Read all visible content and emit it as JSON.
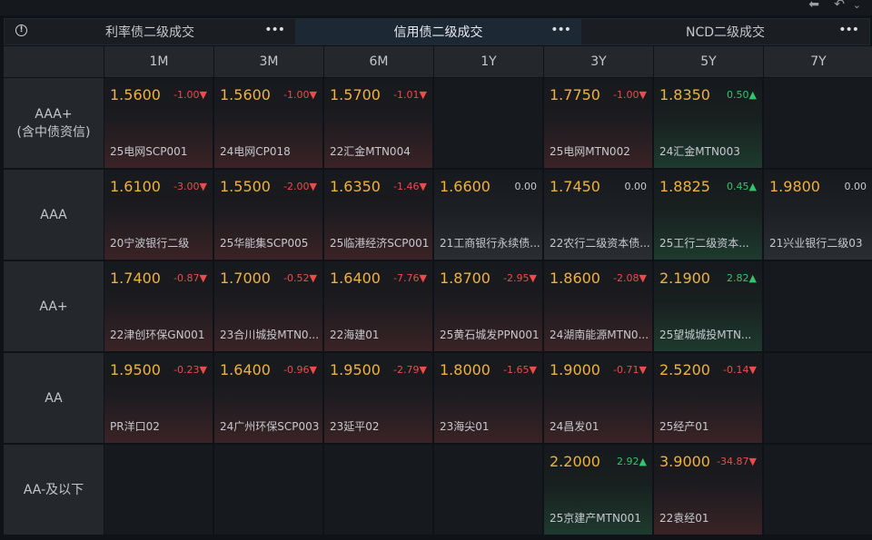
{
  "tabs": [
    {
      "label": "利率债二级成交",
      "more": "•••"
    },
    {
      "label": "信用债二级成交",
      "more": "•••"
    },
    {
      "label": "NCD二级成交",
      "more": "•••"
    }
  ],
  "columns": [
    "1M",
    "3M",
    "6M",
    "1Y",
    "3Y",
    "5Y",
    "7Y"
  ],
  "rows": [
    {
      "label": "AAA+",
      "sublabel": "(含中债资信)",
      "cells": [
        {
          "price": "1.5600",
          "change": "-1.00▼",
          "bond": "25电网SCP001",
          "trend": "down"
        },
        {
          "price": "1.5600",
          "change": "-1.00▼",
          "bond": "24电网CP018",
          "trend": "down"
        },
        {
          "price": "1.5700",
          "change": "-1.01▼",
          "bond": "22汇金MTN004",
          "trend": "down"
        },
        null,
        {
          "price": "1.7750",
          "change": "-1.00▼",
          "bond": "25电网MTN002",
          "trend": "down"
        },
        {
          "price": "1.8350",
          "change": "0.50▲",
          "bond": "24汇金MTN003",
          "trend": "up"
        },
        null
      ]
    },
    {
      "label": "AAA",
      "sublabel": "",
      "cells": [
        {
          "price": "1.6100",
          "change": "-3.00▼",
          "bond": "20宁波银行二级",
          "trend": "down"
        },
        {
          "price": "1.5500",
          "change": "-2.00▼",
          "bond": "25华能集SCP005",
          "trend": "down"
        },
        {
          "price": "1.6350",
          "change": "-1.46▼",
          "bond": "25临港经济SCP001",
          "trend": "down"
        },
        {
          "price": "1.6600",
          "change": "0.00",
          "bond": "21工商银行永续债...",
          "trend": "flat"
        },
        {
          "price": "1.7450",
          "change": "0.00",
          "bond": "22农行二级资本债...",
          "trend": "flat"
        },
        {
          "price": "1.8825",
          "change": "0.45▲",
          "bond": "25工行二级资本...",
          "trend": "up"
        },
        {
          "price": "1.9800",
          "change": "0.00",
          "bond": "21兴业银行二级03",
          "trend": "flat"
        }
      ]
    },
    {
      "label": "AA+",
      "sublabel": "",
      "cells": [
        {
          "price": "1.7400",
          "change": "-0.87▼",
          "bond": "22津创环保GN001",
          "trend": "down"
        },
        {
          "price": "1.7000",
          "change": "-0.52▼",
          "bond": "23合川城投MTN0...",
          "trend": "down"
        },
        {
          "price": "1.6400",
          "change": "-7.76▼",
          "bond": "22海建01",
          "trend": "down"
        },
        {
          "price": "1.8700",
          "change": "-2.95▼",
          "bond": "25黄石城发PPN001",
          "trend": "down"
        },
        {
          "price": "1.8600",
          "change": "-2.08▼",
          "bond": "24湖南能源MTN0...",
          "trend": "down"
        },
        {
          "price": "2.1900",
          "change": "2.82▲",
          "bond": "25望城城投MTN...",
          "trend": "up"
        },
        null
      ]
    },
    {
      "label": "AA",
      "sublabel": "",
      "cells": [
        {
          "price": "1.9500",
          "change": "-0.23▼",
          "bond": "PR洋口02",
          "trend": "down"
        },
        {
          "price": "1.6400",
          "change": "-0.96▼",
          "bond": "24广州环保SCP003",
          "trend": "down"
        },
        {
          "price": "1.9500",
          "change": "-2.79▼",
          "bond": "23延平02",
          "trend": "down"
        },
        {
          "price": "1.8000",
          "change": "-1.65▼",
          "bond": "23海尖01",
          "trend": "down"
        },
        {
          "price": "1.9000",
          "change": "-0.71▼",
          "bond": "24昌发01",
          "trend": "down"
        },
        {
          "price": "2.5200",
          "change": "-0.14▼",
          "bond": "25经产01",
          "trend": "down"
        },
        null
      ]
    },
    {
      "label": "AA-及以下",
      "sublabel": "",
      "cells": [
        null,
        null,
        null,
        null,
        {
          "price": "2.2000",
          "change": "2.92▲",
          "bond": "25京建产MTN001",
          "trend": "up"
        },
        {
          "price": "3.9000",
          "change": "-34.87▼",
          "bond": "22袁经01",
          "trend": "down"
        },
        null
      ]
    }
  ],
  "colors": {
    "price": "#f0b23c",
    "down": "#ec4b4b",
    "up": "#34c46a",
    "flat": "#c7cacf",
    "active_tab": "#1d2835"
  }
}
